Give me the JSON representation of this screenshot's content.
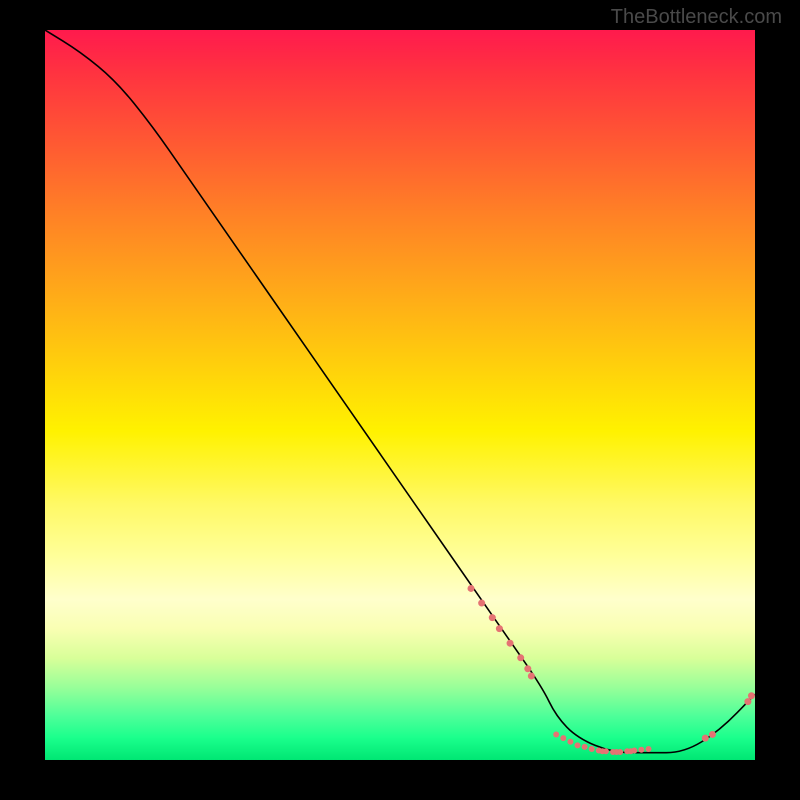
{
  "watermark": "TheBottleneck.com",
  "chart_data": {
    "type": "line",
    "title": "",
    "xlabel": "",
    "ylabel": "",
    "xlim": [
      0,
      100
    ],
    "ylim": [
      0,
      100
    ],
    "curve": {
      "x": [
        0,
        5,
        10,
        15,
        20,
        25,
        30,
        35,
        40,
        45,
        50,
        55,
        60,
        65,
        70,
        72,
        75,
        80,
        85,
        90,
        95,
        100
      ],
      "y": [
        100,
        97,
        93,
        87,
        80,
        73,
        66,
        59,
        52,
        45,
        38,
        31,
        24,
        17,
        10,
        6,
        3,
        1,
        1,
        1,
        4,
        9
      ]
    },
    "points": {
      "segment1": {
        "x": [
          60,
          61.5,
          63,
          64,
          65.5,
          67,
          68,
          68.5
        ],
        "y": [
          23.5,
          21.5,
          19.5,
          18,
          16,
          14,
          12.5,
          11.5
        ],
        "color": "#e57373",
        "size": 7
      },
      "segment2": {
        "x": [
          72,
          73,
          74,
          75,
          76,
          77,
          78,
          78.5,
          79,
          80,
          80.5,
          81,
          82,
          82.5,
          83,
          84,
          85
        ],
        "y": [
          3.5,
          3,
          2.5,
          2,
          1.8,
          1.5,
          1.3,
          1.2,
          1.2,
          1.1,
          1.1,
          1.1,
          1.2,
          1.2,
          1.3,
          1.4,
          1.5
        ],
        "color": "#e57373",
        "size": 6
      },
      "segment3": {
        "x": [
          93,
          94,
          99,
          99.5
        ],
        "y": [
          3,
          3.5,
          8,
          8.8
        ],
        "color": "#e57373",
        "size": 7
      }
    }
  }
}
